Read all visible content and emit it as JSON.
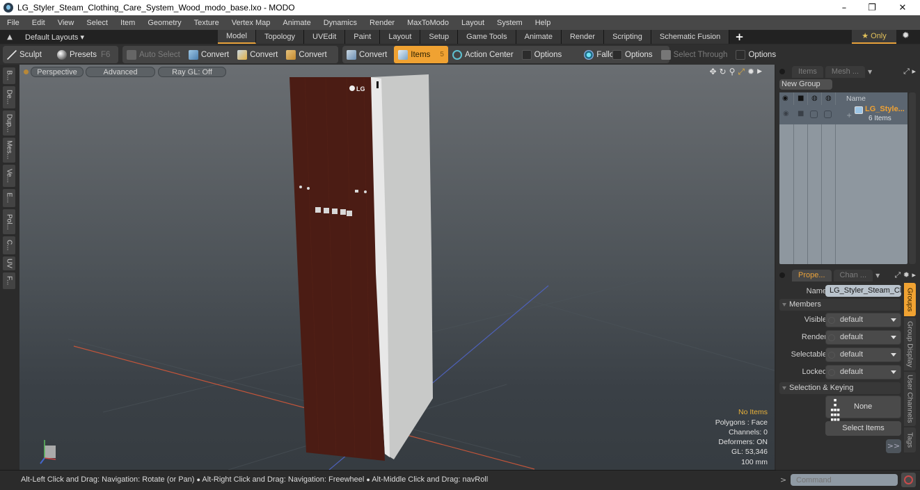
{
  "window": {
    "title": "LG_Styler_Steam_Clothing_Care_System_Wood_modo_base.lxo - MODO",
    "controls": {
      "minimize": "–",
      "maximize": "❐",
      "close": "✕"
    }
  },
  "menu": [
    "File",
    "Edit",
    "View",
    "Select",
    "Item",
    "Geometry",
    "Texture",
    "Vertex Map",
    "Animate",
    "Dynamics",
    "Render",
    "MaxToModo",
    "Layout",
    "System",
    "Help"
  ],
  "layout_bar": {
    "layouts_label": "Default Layouts ▾",
    "tabs": [
      "Model",
      "Topology",
      "UVEdit",
      "Paint",
      "Layout",
      "Setup",
      "Game Tools",
      "Animate",
      "Render",
      "Scripting",
      "Schematic Fusion"
    ],
    "active_tab": "Model",
    "add_tab": "+",
    "only_label": "★ Only"
  },
  "toolbar": {
    "sculpt": "Sculpt",
    "presets": "Presets",
    "presets_key": "F6",
    "auto_select": "Auto Select",
    "convert_1": "Convert",
    "convert_2": "Convert",
    "convert_3": "Convert",
    "convert_4": "Convert",
    "items": "Items",
    "items_key": "5",
    "action_center": "Action Center",
    "options_1": "Options",
    "falloff": "Falloff",
    "options_2": "Options",
    "select_through": "Select Through",
    "options_3": "Options"
  },
  "left_tabs": [
    "B...",
    "De...",
    "Dup...",
    "Mes...",
    "Ve...",
    "E...",
    "Pol...",
    "C...",
    "UV",
    "F..."
  ],
  "viewport": {
    "view_mode": "Perspective",
    "shading": "Advanced",
    "raygl": "Ray GL: Off",
    "product_logo": "LG",
    "hud": {
      "selection": "No Items",
      "polygons": "Polygons : Face",
      "channels": "Channels: 0",
      "deformers": "Deformers: ON",
      "gl": "GL: 53,346",
      "scale": "100 mm"
    },
    "colors": {
      "door": "#4b1c14",
      "body": "#c8c9c8",
      "x_axis": "#c4553a",
      "z_axis": "#4e61b8"
    }
  },
  "status_bar": {
    "hint_1": "Alt-Left Click and Drag: Navigation: Rotate (or Pan)",
    "hint_2": "Alt-Right Click and Drag: Navigation: Freewheel",
    "hint_3": "Alt-Middle Click and Drag: navRoll",
    "separator": "●"
  },
  "items_panel": {
    "tabs": [
      "Items",
      "Mesh ..."
    ],
    "new_group": "New Group",
    "column_name": "Name",
    "group": {
      "name": "LG_Style...",
      "count": "6 Items"
    }
  },
  "properties_panel": {
    "tabs": [
      "Prope...",
      "Chan ..."
    ],
    "name_label": "Name",
    "name_value": "LG_Styler_Steam_Cl",
    "members_section": "Members",
    "fields": [
      {
        "label": "Visible",
        "value": "default"
      },
      {
        "label": "Render",
        "value": "default"
      },
      {
        "label": "Selectable",
        "value": "default"
      },
      {
        "label": "Locked",
        "value": "default"
      }
    ],
    "keying_section": "Selection & Keying",
    "none_button": "None",
    "select_items_button": "Select Items",
    "more_button": ">>",
    "side_tabs": [
      "Groups",
      "Group Display",
      "User Channels",
      "Tags"
    ]
  },
  "command_bar": {
    "prompt": ">",
    "placeholder": "Command"
  },
  "accent_color": "#f0a232"
}
